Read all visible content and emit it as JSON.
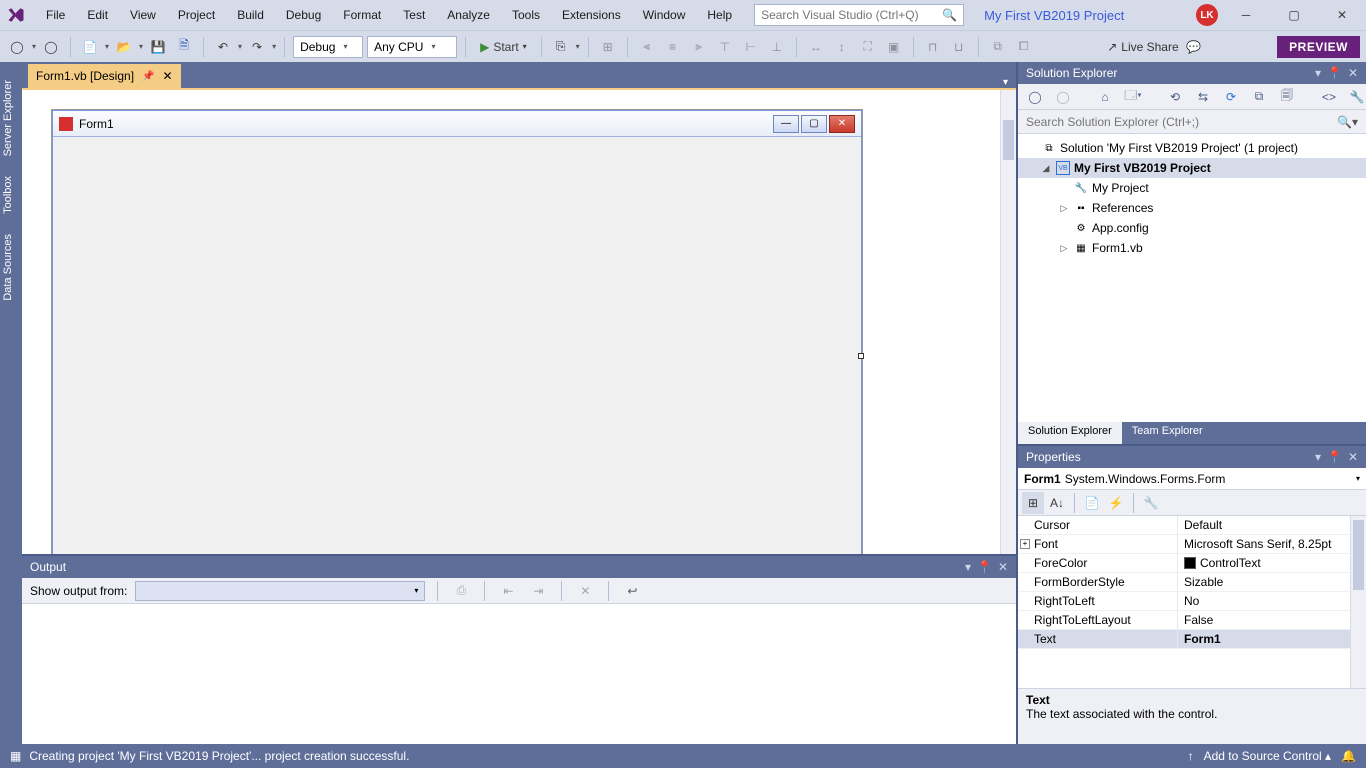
{
  "menu": [
    "File",
    "Edit",
    "View",
    "Project",
    "Build",
    "Debug",
    "Format",
    "Test",
    "Analyze",
    "Tools",
    "Extensions",
    "Window",
    "Help"
  ],
  "search": {
    "placeholder": "Search Visual Studio (Ctrl+Q)"
  },
  "projectName": "My First VB2019 Project",
  "avatar": "LK",
  "toolbar": {
    "config": "Debug",
    "platform": "Any CPU",
    "start": "Start",
    "liveshare": "Live Share",
    "preview": "PREVIEW"
  },
  "leftTabs": [
    "Server Explorer",
    "Toolbox",
    "Data Sources"
  ],
  "docTab": {
    "title": "Form1.vb [Design]"
  },
  "form": {
    "title": "Form1"
  },
  "output": {
    "title": "Output",
    "showFrom": "Show output from:"
  },
  "solutionExplorer": {
    "title": "Solution Explorer",
    "searchPlaceholder": "Search Solution Explorer (Ctrl+;)",
    "nodes": {
      "solution": "Solution 'My First VB2019 Project' (1 project)",
      "project": "My First VB2019 Project",
      "myProject": "My Project",
      "references": "References",
      "appConfig": "App.config",
      "form1": "Form1.vb"
    },
    "tabs": {
      "se": "Solution Explorer",
      "te": "Team Explorer"
    }
  },
  "properties": {
    "title": "Properties",
    "objName": "Form1",
    "objType": "System.Windows.Forms.Form",
    "rows": [
      {
        "name": "Cursor",
        "value": "Default"
      },
      {
        "name": "Font",
        "value": "Microsoft Sans Serif, 8.25pt",
        "expandable": true
      },
      {
        "name": "ForeColor",
        "value": "ControlText",
        "swatch": true
      },
      {
        "name": "FormBorderStyle",
        "value": "Sizable"
      },
      {
        "name": "RightToLeft",
        "value": "No"
      },
      {
        "name": "RightToLeftLayout",
        "value": "False"
      },
      {
        "name": "Text",
        "value": "Form1",
        "selected": true,
        "bold": true
      }
    ],
    "desc": {
      "name": "Text",
      "text": "The text associated with the control."
    }
  },
  "status": {
    "msg": "Creating project 'My First VB2019 Project'... project creation successful.",
    "srcControl": "Add to Source Control"
  }
}
